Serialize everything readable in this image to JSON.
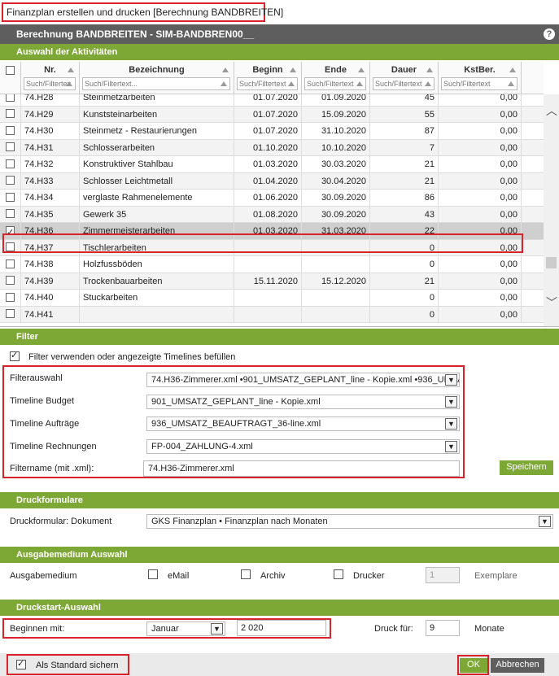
{
  "window": {
    "title": "Finanzplan erstellen und drucken [Berechnung BANDBREITEN]"
  },
  "header": {
    "title": "Berechnung BANDBREITEN - SIM-BANDBREN00__",
    "help_icon": "?"
  },
  "sections": {
    "activities": "Auswahl der Aktivitäten",
    "filter": "Filter",
    "forms": "Druckformulare",
    "output": "Ausgabemedium Auswahl",
    "start": "Druckstart-Auswahl"
  },
  "table": {
    "columns": [
      "Nr.",
      "Bezeichnung",
      "Beginn",
      "Ende",
      "Dauer",
      "KstBer."
    ],
    "filter_placeholders": [
      "Such/Filtertex",
      "Such/Filtertext...",
      "Such/Filtertext",
      "Such/Filtertext",
      "Such/Filtertext",
      "Such/Filtertext"
    ],
    "rows": [
      {
        "checked": false,
        "nr": "74.H28",
        "bez": "Steinmetzarbeiten",
        "beginn": "01.07.2020",
        "ende": "01.09.2020",
        "dauer": "45",
        "kst": "0,00"
      },
      {
        "checked": false,
        "nr": "74.H29",
        "bez": "Kunststeinarbeiten",
        "beginn": "01.07.2020",
        "ende": "15.09.2020",
        "dauer": "55",
        "kst": "0,00"
      },
      {
        "checked": false,
        "nr": "74.H30",
        "bez": "Steinmetz - Restaurierungen",
        "beginn": "01.07.2020",
        "ende": "31.10.2020",
        "dauer": "87",
        "kst": "0,00"
      },
      {
        "checked": false,
        "nr": "74.H31",
        "bez": "Schlosserarbeiten",
        "beginn": "01.10.2020",
        "ende": "10.10.2020",
        "dauer": "7",
        "kst": "0,00"
      },
      {
        "checked": false,
        "nr": "74.H32",
        "bez": "Konstruktiver Stahlbau",
        "beginn": "01.03.2020",
        "ende": "30.03.2020",
        "dauer": "21",
        "kst": "0,00"
      },
      {
        "checked": false,
        "nr": "74.H33",
        "bez": "Schlosser Leichtmetall",
        "beginn": "01.04.2020",
        "ende": "30.04.2020",
        "dauer": "21",
        "kst": "0,00"
      },
      {
        "checked": false,
        "nr": "74.H34",
        "bez": "verglaste Rahmenelemente",
        "beginn": "01.06.2020",
        "ende": "30.09.2020",
        "dauer": "86",
        "kst": "0,00"
      },
      {
        "checked": false,
        "nr": "74.H35",
        "bez": "Gewerk 35",
        "beginn": "01.08.2020",
        "ende": "30.09.2020",
        "dauer": "43",
        "kst": "0,00"
      },
      {
        "checked": true,
        "nr": "74.H36",
        "bez": "Zimmermeisterarbeiten",
        "beginn": "01.03.2020",
        "ende": "31.03.2020",
        "dauer": "22",
        "kst": "0,00"
      },
      {
        "checked": false,
        "nr": "74.H37",
        "bez": "Tischlerarbeiten",
        "beginn": "",
        "ende": "",
        "dauer": "0",
        "kst": "0,00"
      },
      {
        "checked": false,
        "nr": "74.H38",
        "bez": "Holzfussböden",
        "beginn": "",
        "ende": "",
        "dauer": "0",
        "kst": "0,00"
      },
      {
        "checked": false,
        "nr": "74.H39",
        "bez": "Trockenbauarbeiten",
        "beginn": "15.11.2020",
        "ende": "15.12.2020",
        "dauer": "21",
        "kst": "0,00"
      },
      {
        "checked": false,
        "nr": "74.H40",
        "bez": "Stuckarbeiten",
        "beginn": "",
        "ende": "",
        "dauer": "0",
        "kst": "0,00"
      },
      {
        "checked": false,
        "nr": "74.H41",
        "bez": "",
        "beginn": "",
        "ende": "",
        "dauer": "0",
        "kst": "0,00"
      }
    ]
  },
  "filter": {
    "use_label": "Filter verwenden oder angezeigte Timelines befüllen",
    "labels": {
      "auswahl": "Filterauswahl",
      "budget": "Timeline Budget",
      "auftraege": "Timeline Aufträge",
      "rechnungen": "Timeline Rechnungen",
      "name": "Filtername (mit .xml):"
    },
    "values": {
      "auswahl": "74.H36-Zimmerer.xml •901_UMSATZ_GEPLANT_line - Kopie.xml •936_UMSA",
      "budget": "901_UMSATZ_GEPLANT_line - Kopie.xml",
      "auftraege": "936_UMSATZ_BEAUFTRAGT_36-line.xml",
      "rechnungen": "FP-004_ZAHLUNG-4.xml",
      "name": "74.H36-Zimmerer.xml"
    },
    "save_button": "Speichern"
  },
  "forms": {
    "label": "Druckformular: Dokument",
    "value": "GKS Finanzplan • Finanzplan nach Monaten"
  },
  "output": {
    "label": "Ausgabemedium",
    "email": "eMail",
    "archiv": "Archiv",
    "drucker": "Drucker",
    "copies": "1",
    "copies_label": "Exemplare"
  },
  "start": {
    "label": "Beginnen mit:",
    "month": "Januar",
    "year": "2 020",
    "print_for_label": "Druck für:",
    "months_value": "9",
    "months_label": "Monate"
  },
  "footer": {
    "default_label": "Als Standard sichern",
    "ok": "OK",
    "cancel": "Abbrechen"
  }
}
